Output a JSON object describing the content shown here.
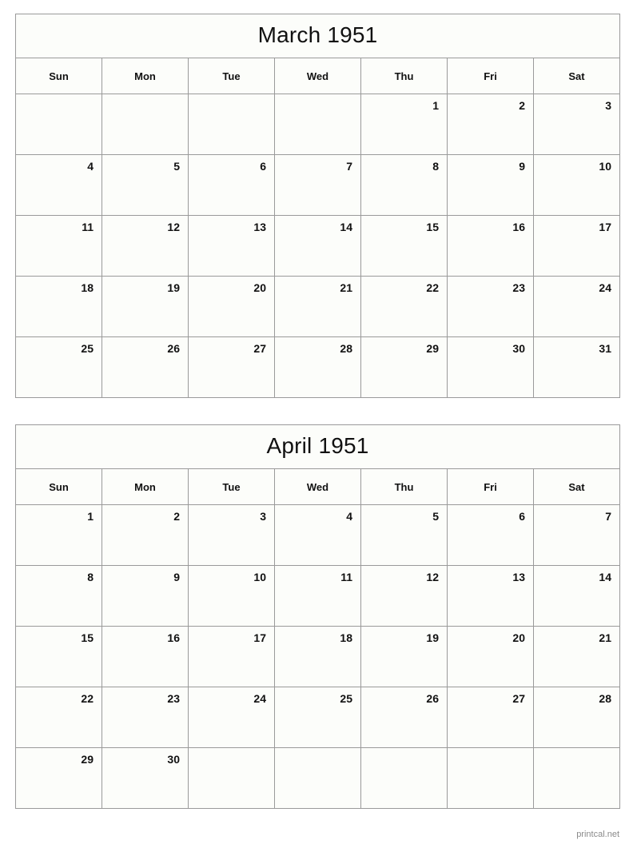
{
  "document": {
    "type": "printable-calendar",
    "footer_credit": "printcal.net",
    "colors": {
      "border": "#9a9a9a",
      "cell_background": "#fcfdfa",
      "text": "#111111",
      "footer_text": "#8a8a8a"
    }
  },
  "calendars": [
    {
      "title": "March 1951",
      "weekday_headers": [
        "Sun",
        "Mon",
        "Tue",
        "Wed",
        "Thu",
        "Fri",
        "Sat"
      ],
      "weeks": [
        [
          "",
          "",
          "",
          "",
          "1",
          "2",
          "3"
        ],
        [
          "4",
          "5",
          "6",
          "7",
          "8",
          "9",
          "10"
        ],
        [
          "11",
          "12",
          "13",
          "14",
          "15",
          "16",
          "17"
        ],
        [
          "18",
          "19",
          "20",
          "21",
          "22",
          "23",
          "24"
        ],
        [
          "25",
          "26",
          "27",
          "28",
          "29",
          "30",
          "31"
        ]
      ]
    },
    {
      "title": "April 1951",
      "weekday_headers": [
        "Sun",
        "Mon",
        "Tue",
        "Wed",
        "Thu",
        "Fri",
        "Sat"
      ],
      "weeks": [
        [
          "1",
          "2",
          "3",
          "4",
          "5",
          "6",
          "7"
        ],
        [
          "8",
          "9",
          "10",
          "11",
          "12",
          "13",
          "14"
        ],
        [
          "15",
          "16",
          "17",
          "18",
          "19",
          "20",
          "21"
        ],
        [
          "22",
          "23",
          "24",
          "25",
          "26",
          "27",
          "28"
        ],
        [
          "29",
          "30",
          "",
          "",
          "",
          "",
          ""
        ]
      ]
    }
  ]
}
